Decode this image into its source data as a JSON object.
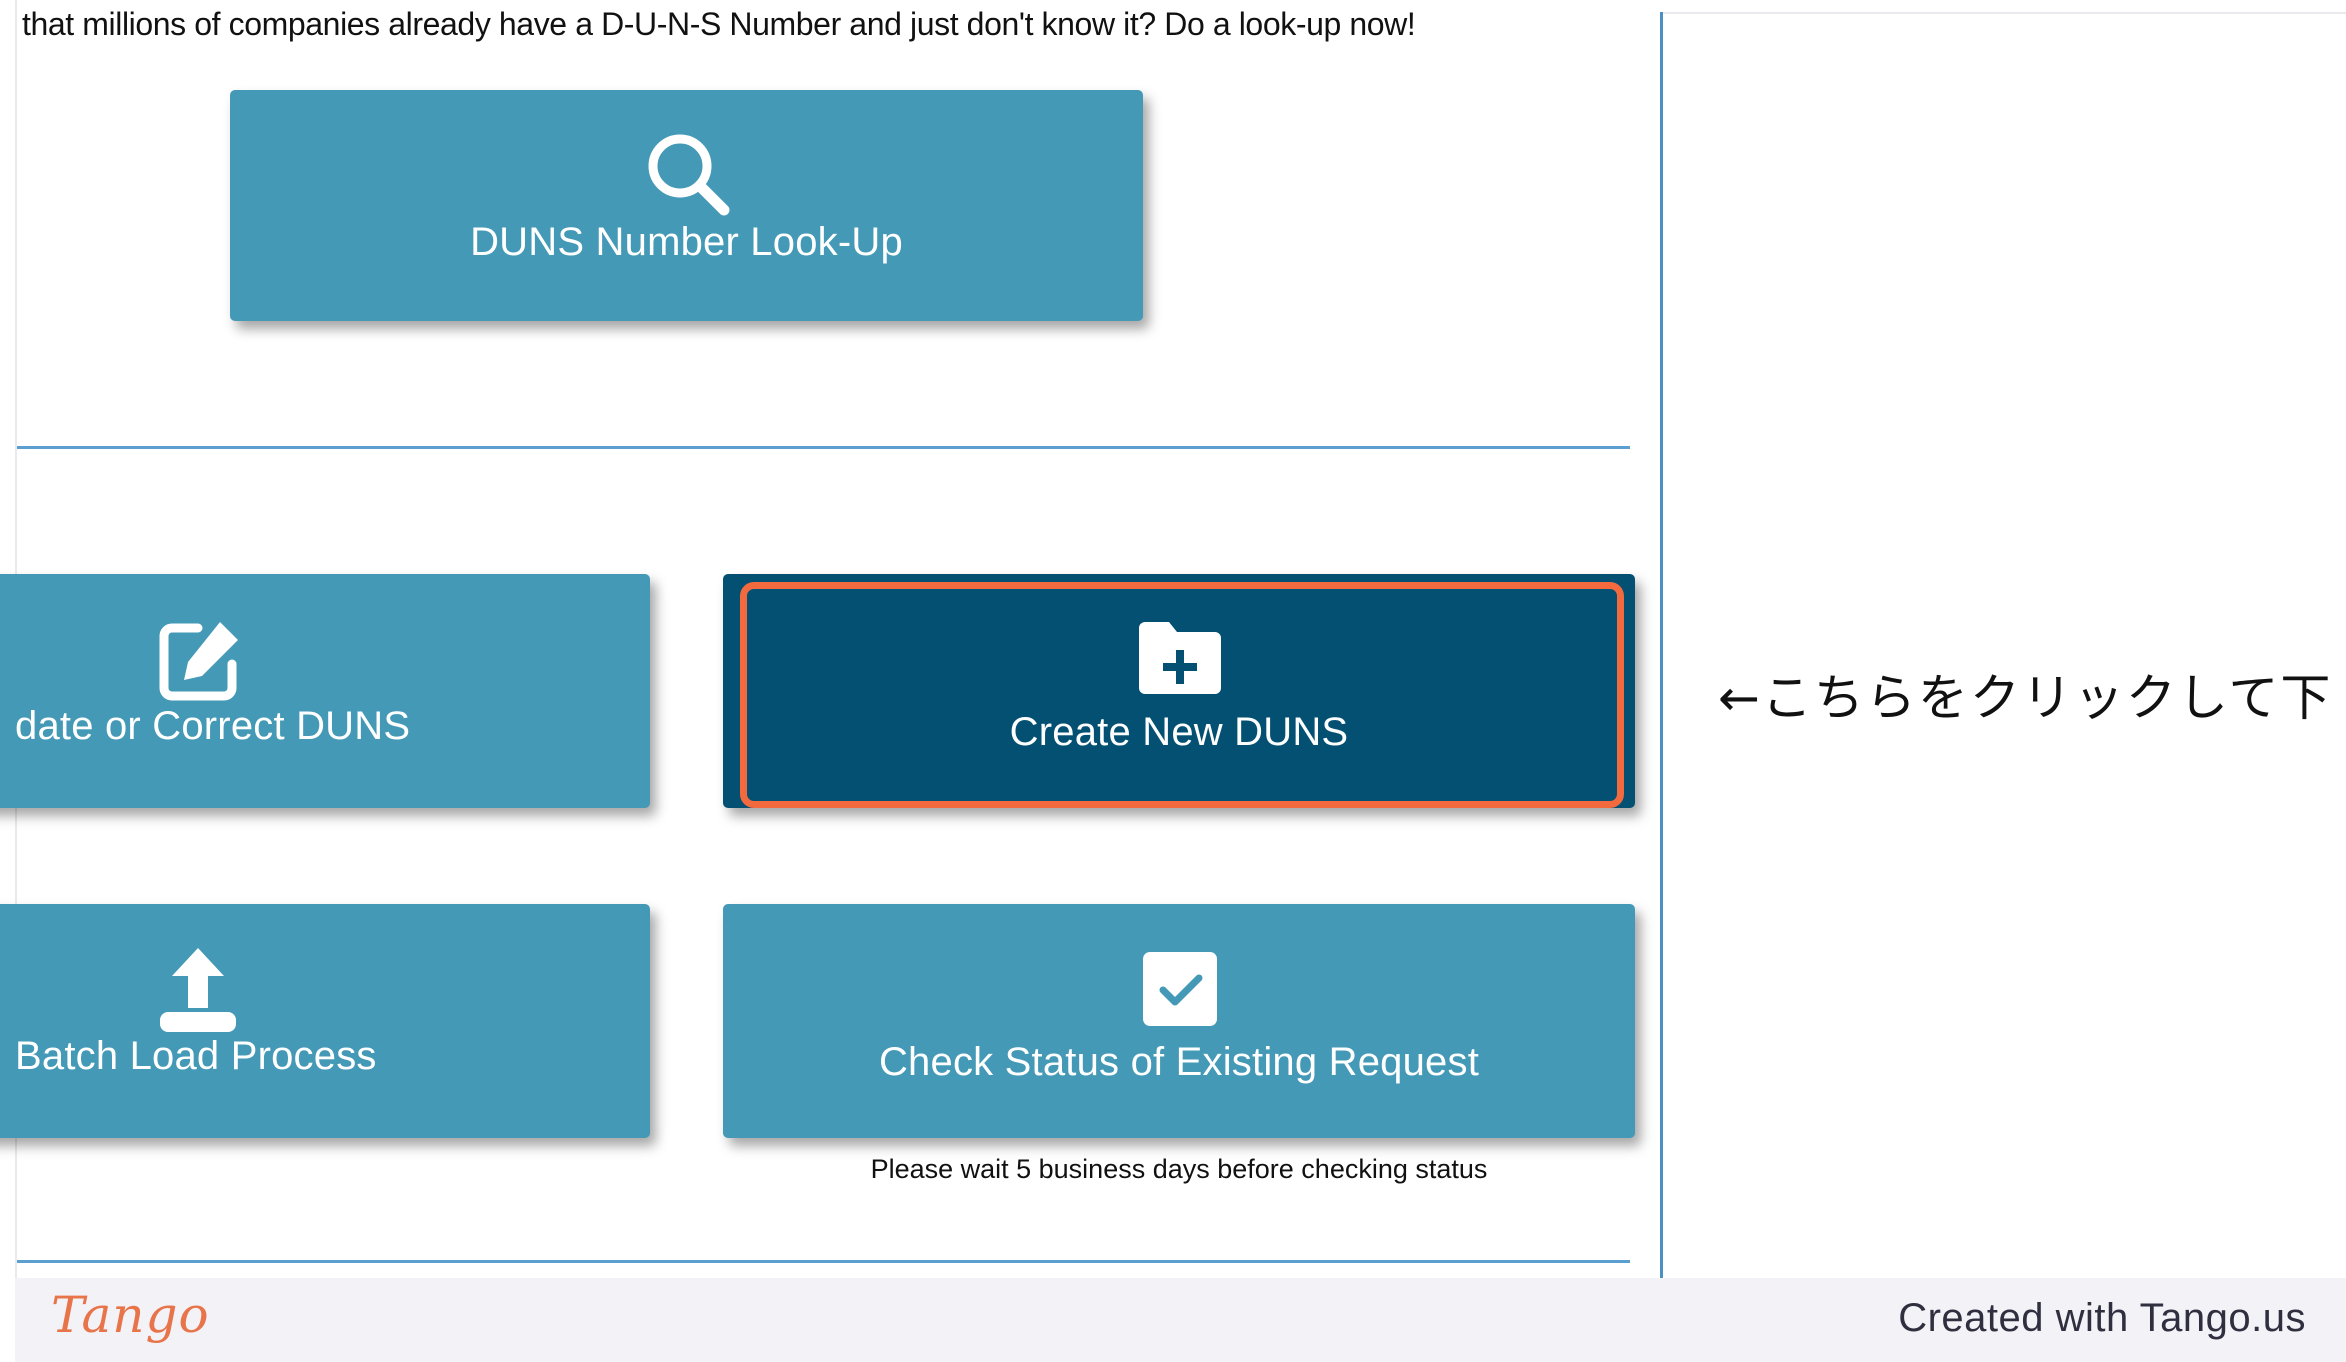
{
  "intro": {
    "text": "that millions of companies already have a D-U-N-S Number and just don't know it? Do a look-up now!"
  },
  "tiles": {
    "lookup": {
      "label": "DUNS Number Look-Up",
      "icon": "search-icon"
    },
    "update": {
      "label": "date or Correct DUNS",
      "icon": "edit-icon"
    },
    "create": {
      "label": "Create New DUNS",
      "icon": "folder-plus-icon"
    },
    "batch": {
      "label": "Batch Load Process",
      "icon": "upload-icon"
    },
    "check": {
      "label": "Check Status of Existing Request",
      "icon": "checkbox-icon"
    }
  },
  "wait_note": "Please wait 5 business days before checking status",
  "annotation": "←こちらをクリックして下",
  "footer": {
    "logo": "Tango",
    "credit": "Created with Tango.us"
  },
  "colors": {
    "tile": "#4399b6",
    "tile_active": "#045072",
    "highlight": "#f26a3d",
    "divider": "#5b9fd0",
    "logo": "#e8744a"
  }
}
